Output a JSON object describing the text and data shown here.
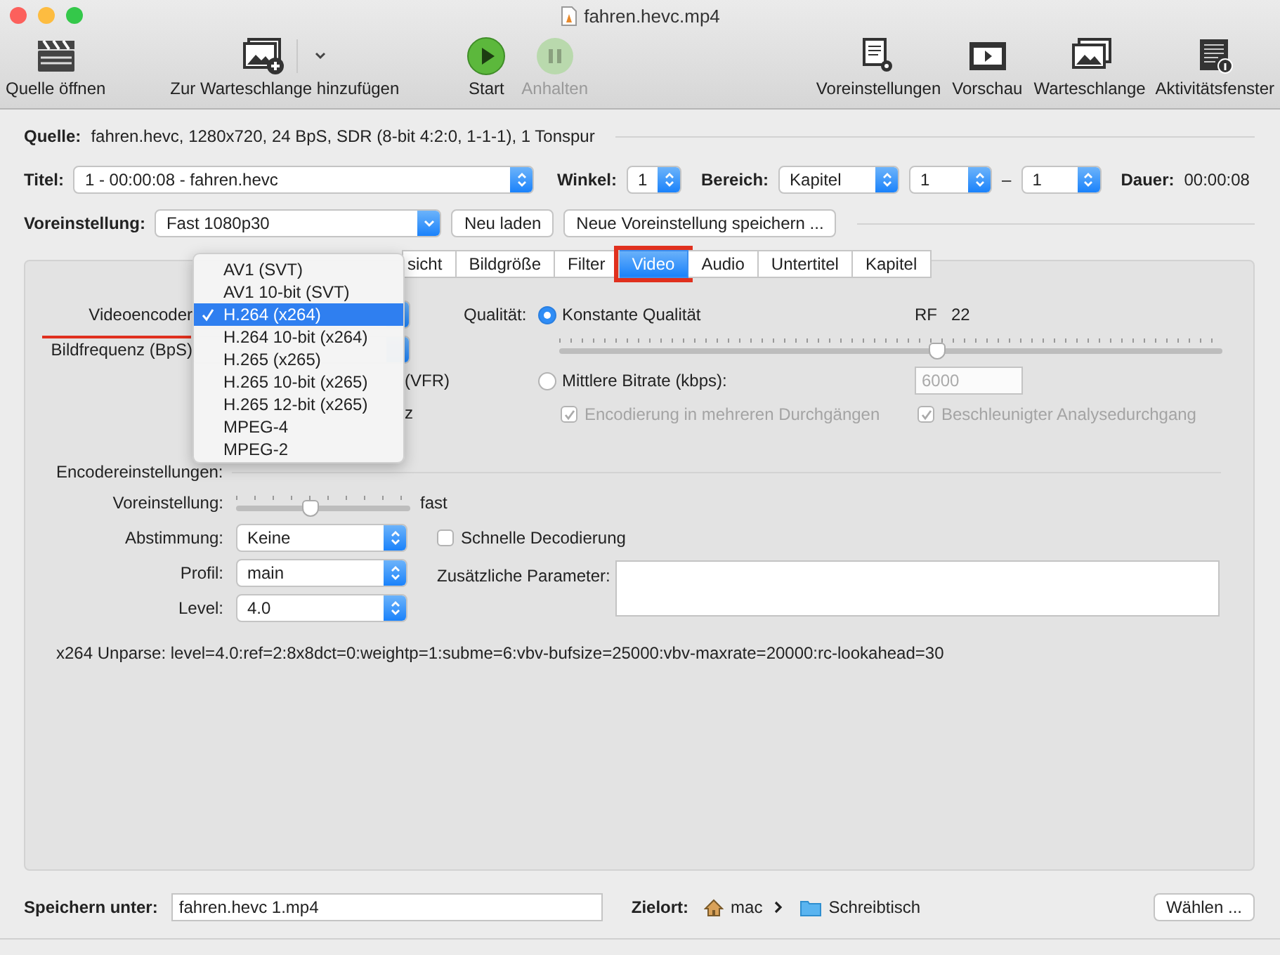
{
  "window": {
    "title": "fahren.hevc.mp4"
  },
  "toolbar": [
    {
      "kind": "open",
      "label": "Quelle öffnen",
      "disabled": false
    },
    {
      "kind": "queue_add",
      "label": "Zur Warteschlange hinzufügen",
      "disabled": false
    },
    {
      "kind": "start",
      "label": "Start",
      "disabled": false
    },
    {
      "kind": "pause",
      "label": "Anhalten",
      "disabled": true
    },
    {
      "kind": "presets",
      "label": "Voreinstellungen",
      "disabled": false
    },
    {
      "kind": "preview",
      "label": "Vorschau",
      "disabled": false
    },
    {
      "kind": "queue",
      "label": "Warteschlange",
      "disabled": false
    },
    {
      "kind": "activity",
      "label": "Aktivitätsfenster",
      "disabled": false
    }
  ],
  "source": {
    "label": "Quelle:",
    "value": "fahren.hevc, 1280x720, 24 BpS, SDR (8-bit 4:2:0, 1-1-1), 1 Tonspur"
  },
  "title_row": {
    "label": "Titel:",
    "value": "1 - 00:00:08 - fahren.hevc"
  },
  "angle": {
    "label": "Winkel:",
    "value": "1"
  },
  "range": {
    "label": "Bereich:",
    "mode": "Kapitel",
    "from": "1",
    "separator": "–",
    "to": "1"
  },
  "duration": {
    "label": "Dauer:",
    "value": "00:00:08"
  },
  "preset": {
    "label": "Voreinstellung:",
    "value": "Fast 1080p30",
    "buttons": [
      "Neu laden",
      "Neue Voreinstellung speichern ..."
    ]
  },
  "tabs": [
    {
      "label": "sicht",
      "selected": false,
      "highlighted": false
    },
    {
      "label": "Bildgröße",
      "selected": false,
      "highlighted": false
    },
    {
      "label": "Filter",
      "selected": false,
      "highlighted": false
    },
    {
      "label": "Video",
      "selected": true,
      "highlighted": true
    },
    {
      "label": "Audio",
      "selected": false,
      "highlighted": false
    },
    {
      "label": "Untertitel",
      "selected": false,
      "highlighted": false
    },
    {
      "label": "Kapitel",
      "selected": false,
      "highlighted": false
    }
  ],
  "video": {
    "encoder_label": "Videoencoder",
    "encoder_underlined": true,
    "framerate_label": "Bildfrequenz (BpS)",
    "partial_texts": [
      "(VFR)",
      "z"
    ],
    "quality": {
      "label": "Qualität:",
      "rf_label": "RF",
      "rf_value": "22",
      "level": 0.57,
      "options": [
        {
          "label": "Konstante Qualität",
          "selected": true
        },
        {
          "label": "Mittlere Bitrate (kbps):",
          "selected": false
        }
      ],
      "bitrate": {
        "value": "6000",
        "disabled": true
      },
      "checks": [
        {
          "label": "Encodierung in mehreren Durchgängen",
          "checked": true,
          "disabled": true
        },
        {
          "label": "Beschleunigter Analysedurchgang",
          "checked": true,
          "disabled": true
        }
      ]
    },
    "encoder_settings": {
      "heading": "Encodereinstellungen:",
      "speed": {
        "label": "Voreinstellung:",
        "level": 0.43,
        "value": "fast"
      },
      "tune": {
        "label": "Abstimmung:",
        "value": "Keine"
      },
      "fast_decode": {
        "label": "Schnelle Decodierung",
        "checked": false
      },
      "profile": {
        "label": "Profil:",
        "value": "main"
      },
      "extra": {
        "label": "Zusätzliche Parameter:"
      },
      "level": {
        "label": "Level:",
        "value": "4.0"
      }
    },
    "unparse": "x264 Unparse: level=4.0:ref=2:8x8dct=0:weightp=1:subme=6:vbv-bufsize=25000:vbv-maxrate=20000:rc-lookahead=30"
  },
  "encoder_menu": [
    {
      "label": "AV1 (SVT)",
      "selected": false
    },
    {
      "label": "AV1 10-bit (SVT)",
      "selected": false
    },
    {
      "label": "H.264 (x264)",
      "selected": true
    },
    {
      "label": "H.264 10-bit (x264)",
      "selected": false
    },
    {
      "label": "H.265 (x265)",
      "selected": false
    },
    {
      "label": "H.265 10-bit (x265)",
      "selected": false
    },
    {
      "label": "H.265 12-bit (x265)",
      "selected": false
    },
    {
      "label": "MPEG-4",
      "selected": false
    },
    {
      "label": "MPEG-2",
      "selected": false
    }
  ],
  "footer": {
    "save_label": "Speichern unter:",
    "filename": "fahren.hevc 1.mp4",
    "dest_label": "Zielort:",
    "path": [
      {
        "kind": "home",
        "label": "mac"
      },
      {
        "kind": "folder",
        "label": "Schreibtisch"
      }
    ],
    "button": "Wählen ..."
  }
}
